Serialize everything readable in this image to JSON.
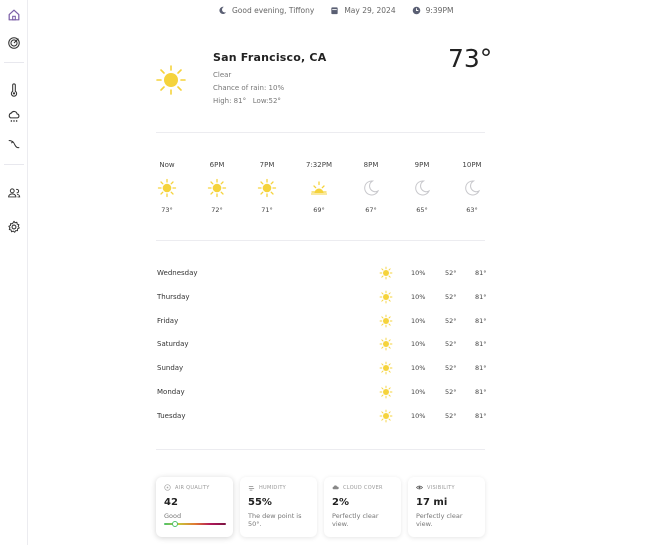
{
  "topbar": {
    "greeting": "Good evening, Tiffony",
    "date": "May 29, 2024",
    "time": "9:39PM"
  },
  "sidebar": {
    "items": [
      {
        "name": "home",
        "icon": "home-icon",
        "active": true
      },
      {
        "name": "radar",
        "icon": "radar-icon",
        "active": false
      },
      {
        "name": "temperature",
        "icon": "thermometer-icon",
        "active": false
      },
      {
        "name": "precipitation",
        "icon": "rain-cloud-icon",
        "active": false
      },
      {
        "name": "wind",
        "icon": "wind-icon",
        "active": false
      },
      {
        "name": "account",
        "icon": "users-icon",
        "active": false
      },
      {
        "name": "settings",
        "icon": "gear-icon",
        "active": false
      }
    ]
  },
  "current": {
    "location": "San Francisco, CA",
    "condition": "Clear",
    "rain_chance": "Chance of rain: 10%",
    "high_low": "High: 81°   Low:52°",
    "temperature": "73°"
  },
  "hourly": [
    {
      "time": "Now",
      "temp": "73°",
      "icon": "sun"
    },
    {
      "time": "6PM",
      "temp": "72°",
      "icon": "sun"
    },
    {
      "time": "7PM",
      "temp": "71°",
      "icon": "sun"
    },
    {
      "time": "7:32PM",
      "temp": "69°",
      "icon": "sunset"
    },
    {
      "time": "8PM",
      "temp": "67°",
      "icon": "moon"
    },
    {
      "time": "9PM",
      "temp": "65°",
      "icon": "moon"
    },
    {
      "time": "10PM",
      "temp": "63°",
      "icon": "moon"
    }
  ],
  "daily": [
    {
      "day": "Wednesday",
      "rain": "10%",
      "low": "52°",
      "high": "81°"
    },
    {
      "day": "Thursday",
      "rain": "10%",
      "low": "52°",
      "high": "81°"
    },
    {
      "day": "Friday",
      "rain": "10%",
      "low": "52°",
      "high": "81°"
    },
    {
      "day": "Saturday",
      "rain": "10%",
      "low": "52°",
      "high": "81°"
    },
    {
      "day": "Sunday",
      "rain": "10%",
      "low": "52°",
      "high": "81°"
    },
    {
      "day": "Monday",
      "rain": "10%",
      "low": "52°",
      "high": "81°"
    },
    {
      "day": "Tuesday",
      "rain": "10%",
      "low": "52°",
      "high": "81°"
    }
  ],
  "cards": {
    "air_quality": {
      "label": "AIR QUALITY",
      "value": "42",
      "desc": "Good",
      "level": 0.17
    },
    "humidity": {
      "label": "HUMIDITY",
      "value": "55%",
      "desc": "The dew point is 50°."
    },
    "cloud_cover": {
      "label": "CLOUD COVER",
      "value": "2%",
      "desc": "Perfectly clear view."
    },
    "visibility": {
      "label": "VISIBILITY",
      "value": "17 mi",
      "desc": "Perfectly clear view."
    }
  },
  "colors": {
    "accent": "#7b5ea7",
    "sun": "#f5d33c",
    "moon": "#c8c8cc",
    "divider": "#ececf0"
  }
}
